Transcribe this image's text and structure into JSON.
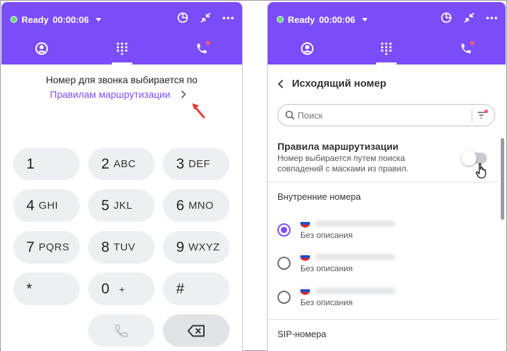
{
  "status": {
    "label": "Ready",
    "timer": "00:00:06",
    "dot_color": "#6fd67a"
  },
  "colors": {
    "accent": "#7b4dfa",
    "key_bg": "#eeeff2",
    "notify": "#ff5b6a"
  },
  "header_icons": [
    "pie-chart-icon",
    "collapse-icon",
    "more-icon"
  ],
  "tabs": [
    "contacts-tab",
    "dialpad-tab",
    "calls-tab"
  ],
  "left": {
    "route_text": "Номер для звонка выбирается по",
    "route_link": "Правилам маршрутизации",
    "keys": [
      {
        "digit": "1",
        "letters": ""
      },
      {
        "digit": "2",
        "letters": "ABC"
      },
      {
        "digit": "3",
        "letters": "DEF"
      },
      {
        "digit": "4",
        "letters": "GHI"
      },
      {
        "digit": "5",
        "letters": "JKL"
      },
      {
        "digit": "6",
        "letters": "MNO"
      },
      {
        "digit": "7",
        "letters": "PQRS"
      },
      {
        "digit": "8",
        "letters": "TUV"
      },
      {
        "digit": "9",
        "letters": "WXYZ"
      },
      {
        "digit": "*",
        "letters": ""
      },
      {
        "digit": "0",
        "letters": "+"
      },
      {
        "digit": "#",
        "letters": ""
      }
    ]
  },
  "right": {
    "title": "Исходящий номер",
    "search_placeholder": "Поиск",
    "rules": {
      "title": "Правила маршрутизации",
      "desc_line1": "Номер выбирается путем поиска",
      "desc_line2": "совпадений с масками из правил.",
      "enabled": false
    },
    "internal_section": "Внутренние номера",
    "numbers": [
      {
        "description": "Без описания",
        "selected": true
      },
      {
        "description": "Без описания",
        "selected": false
      },
      {
        "description": "Без описания",
        "selected": false
      }
    ],
    "sip_section": "SIP-номера"
  }
}
